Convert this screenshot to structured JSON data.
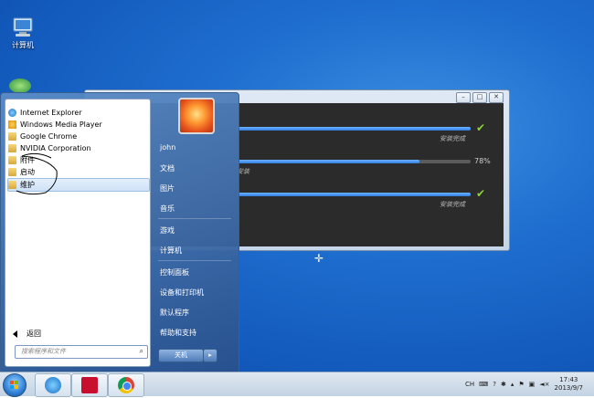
{
  "desktop": {
    "icons": [
      {
        "label": "计算机"
      }
    ]
  },
  "installer": {
    "rows": [
      {
        "status": "安装完成",
        "progress": 1.0,
        "done": true
      },
      {
        "status": "安装",
        "progress": 0.78,
        "percent": "78%",
        "done": false
      },
      {
        "status": "安装完成",
        "progress": 1.0,
        "done": true
      }
    ]
  },
  "start_menu": {
    "programs": [
      {
        "label": "Internet Explorer",
        "icon": "ie-icon"
      },
      {
        "label": "Windows Media Player",
        "icon": "media-player-icon"
      },
      {
        "label": "Google Chrome",
        "icon": "folder-icon"
      },
      {
        "label": "NVIDIA Corporation",
        "icon": "folder-icon"
      },
      {
        "label": "附件",
        "icon": "folder-icon"
      },
      {
        "label": "启动",
        "icon": "folder-icon"
      },
      {
        "label": "维护",
        "icon": "folder-icon"
      }
    ],
    "back_label": "返回",
    "search_placeholder": "搜索程序和文件",
    "right_items": [
      "john",
      "文档",
      "图片",
      "音乐",
      "游戏",
      "计算机",
      "控制面板",
      "设备和打印机",
      "默认程序",
      "帮助和支持"
    ],
    "shutdown_label": "关机"
  },
  "taskbar": {
    "tray": {
      "lang": "CH",
      "time": "17:43",
      "date": "2013/9/7"
    }
  },
  "colors": {
    "accent": "#1f6fd0",
    "progress": "#2f7fe0",
    "check": "#8ad42e"
  }
}
